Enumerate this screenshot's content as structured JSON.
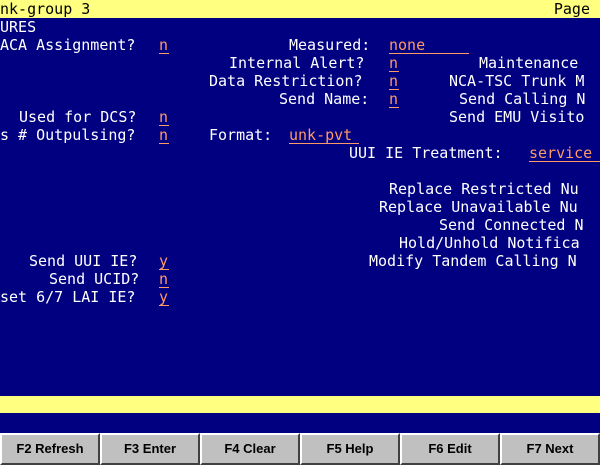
{
  "header": {
    "title": "nk-group 3",
    "page_label": "Page"
  },
  "fields": {
    "section": "URES",
    "aca_label": "ACA Assignment?",
    "aca_value": "n",
    "measured_label": "Measured:",
    "measured_value": "none",
    "internal_alert_label": "Internal Alert?",
    "internal_alert_value": "n",
    "maintenance_label": "Maintenance",
    "data_restriction_label": "Data Restriction?",
    "data_restriction_value": "n",
    "nca_tsc_label": "NCA-TSC Trunk M",
    "send_name_label": "Send Name:",
    "send_name_value": "n",
    "send_calling_label": "Send Calling N",
    "used_for_dcs_label": "Used for DCS?",
    "used_for_dcs_value": "n",
    "send_emu_label": "Send EMU Visito",
    "outpulsing_label": "s # Outpulsing?",
    "outpulsing_value": "n",
    "format_label": "Format:",
    "format_value": "unk-pvt",
    "uui_ie_label": "UUI IE Treatment:",
    "uui_ie_value": "service",
    "replace_restricted_label": "Replace Restricted Nu",
    "replace_unavailable_label": "Replace Unavailable Nu",
    "send_connected_label": "Send Connected N",
    "hold_unhold_label": "Hold/Unhold Notifica",
    "send_uui_label": "Send UUI IE?",
    "send_uui_value": "y",
    "modify_tandem_label": "Modify Tandem Calling N",
    "send_ucid_label": "Send UCID?",
    "send_ucid_value": "n",
    "lai_label": "set 6/7 LAI IE?",
    "lai_value": "y"
  },
  "function_keys": [
    {
      "label": "F2 Refresh"
    },
    {
      "label": "F3 Enter"
    },
    {
      "label": "F4 Clear"
    },
    {
      "label": "F5 Help"
    },
    {
      "label": "F6 Edit"
    },
    {
      "label": "F7 Next"
    }
  ],
  "colors": {
    "background": "#000080",
    "bar": "#ffff80",
    "value": "#ff9966",
    "text": "#ffffff"
  }
}
